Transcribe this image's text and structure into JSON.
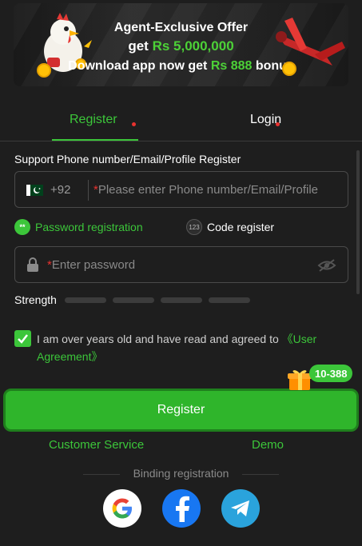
{
  "banner": {
    "line1": "Agent-Exclusive Offer",
    "line2_prefix": "get ",
    "line2_amount": "Rs 5,000,000",
    "line3_prefix": "Download app now get ",
    "line3_amount": "Rs 888",
    "line3_suffix": " bonus"
  },
  "tabs": {
    "register": "Register",
    "login": "Login",
    "active": "register"
  },
  "form": {
    "support_label": "Support Phone number/Email/Profile Register",
    "country_code": "+92",
    "phone_placeholder": "Please enter Phone number/Email/Profile",
    "options": {
      "password_badge": "**",
      "password_registration": "Password registration",
      "code_badge": "123",
      "code_register": "Code register",
      "selected": "password"
    },
    "password_placeholder": "Enter password",
    "strength_label": "Strength",
    "strength_level": 0,
    "agree_text": "I am over years old and have read and agreed to ",
    "agree_link": "《User Agreement》",
    "agree_checked": true
  },
  "register_button": "Register",
  "gift_badge": "10-388",
  "links": {
    "customer_service": "Customer Service",
    "demo": "Demo"
  },
  "binding_label": "Binding registration",
  "social": [
    "google-icon",
    "facebook-icon",
    "telegram-icon"
  ],
  "colors": {
    "accent": "#3cc63a",
    "background": "#1e1e1e",
    "required": "#e8322f",
    "facebook": "#1877f2",
    "telegram": "#2aa3dc"
  }
}
